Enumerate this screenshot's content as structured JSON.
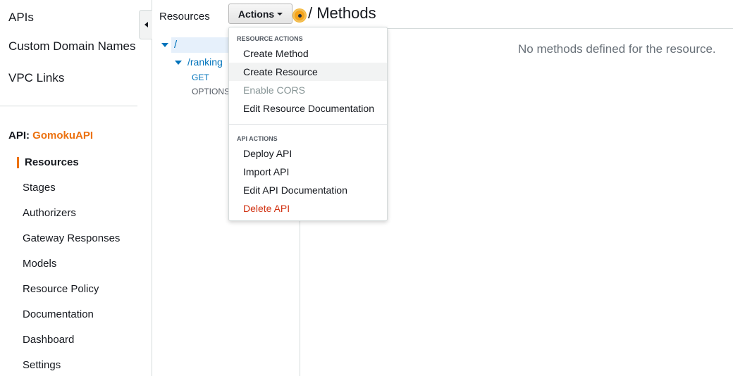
{
  "leftnav": {
    "top_items": [
      "APIs",
      "Custom Domain Names",
      "VPC Links"
    ],
    "api_prefix": "API:",
    "api_name": "GomokuAPI",
    "sub_items": [
      "Resources",
      "Stages",
      "Authorizers",
      "Gateway Responses",
      "Models",
      "Resource Policy",
      "Documentation",
      "Dashboard",
      "Settings"
    ]
  },
  "resources_panel": {
    "header": "Resources",
    "actions_label": "Actions",
    "tree": {
      "root": "/",
      "child": "/ranking",
      "methods": [
        "GET",
        "OPTIONS"
      ]
    }
  },
  "main": {
    "title": "/ Methods",
    "empty_message": "No methods defined for the resource."
  },
  "dropdown": {
    "resource_section": "RESOURCE ACTIONS",
    "resource_items": [
      "Create Method",
      "Create Resource",
      "Enable CORS",
      "Edit Resource Documentation"
    ],
    "api_section": "API ACTIONS",
    "api_items": [
      "Deploy API",
      "Import API",
      "Edit API Documentation",
      "Delete API"
    ]
  },
  "colors": {
    "accent": "#ec7211",
    "link": "#0073bb",
    "danger": "#d13212",
    "muted": "#687078"
  }
}
